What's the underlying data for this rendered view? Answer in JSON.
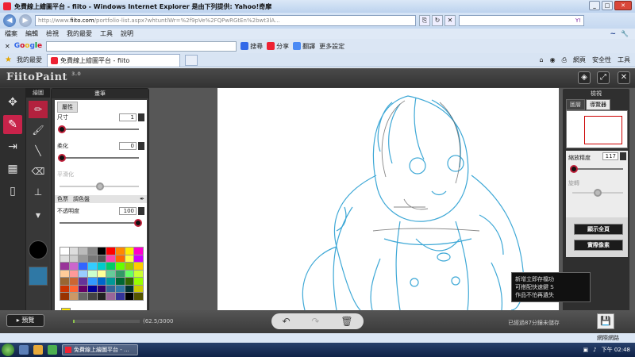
{
  "window": {
    "title": "免費線上繪圖平台 - fiito - Windows Internet Explorer 是由下列提供: Yahoo!奇摩"
  },
  "address": {
    "url_domain": "fiito.com",
    "url_prefix": "http://www.",
    "url_rest": "/portfolio-list.aspx?whtuntlWr=%2f9pVe%2FQPwRGtEn%2bwt3lA..."
  },
  "ie_menu": {
    "items": [
      "檔案",
      "編輯",
      "檢視",
      "我的最愛",
      "工具",
      "說明"
    ]
  },
  "google_bar": {
    "search_label": "搜尋",
    "share_label": "分享",
    "translate_label": "翻譯",
    "more_label": "更多設定"
  },
  "tabs": {
    "favorites_label": "我的最愛",
    "active_tab": "免費線上繪圖平台 - fiito",
    "tools": [
      "網頁",
      "安全性",
      "工具"
    ]
  },
  "app": {
    "logo": "FiitoPaint",
    "version": "3.0",
    "main_tools_label": "繪圖",
    "brush_panel_title": "畫筆",
    "brush_props_tab": "屬性",
    "size_label": "尺寸",
    "size_value": "1",
    "softness_label": "柔化",
    "softness_value": "0",
    "smoothing_label": "平滑化",
    "color_tab_palette": "色票",
    "color_tab_mixer": "調色盤",
    "opacity_label": "不透明度",
    "opacity_value": "100",
    "palette": [
      "#ffffff",
      "#dddddd",
      "#bbbbbb",
      "#888888",
      "#000000",
      "#ff0000",
      "#ff8800",
      "#ffee00",
      "#ff00cc",
      "#dddddd",
      "#cccccc",
      "#999999",
      "#777777",
      "#555555",
      "#ff44aa",
      "#ff6600",
      "#ffff44",
      "#cc00ff",
      "#993399",
      "#cc66cc",
      "#3366ff",
      "#33ccff",
      "#00cccc",
      "#00cc66",
      "#66ff00",
      "#99cc00",
      "#ffcc00",
      "#ffcc99",
      "#ff9999",
      "#99ccff",
      "#ccffcc",
      "#ffff99",
      "#66cc99",
      "#339966",
      "#66ff66",
      "#ccff33",
      "#996633",
      "#cc6633",
      "#663399",
      "#3399ff",
      "#0066cc",
      "#009999",
      "#006633",
      "#336600",
      "#99ff00",
      "#cc3300",
      "#ff6633",
      "#660066",
      "#000099",
      "#330066",
      "#336699",
      "#2f78a5",
      "#003333",
      "#cccc00",
      "#993300",
      "#cc9966",
      "#666666",
      "#444444",
      "#222222",
      "#996699",
      "#333399",
      "#000000",
      "#555500"
    ],
    "current_color": "#ffe600",
    "brush_color_value": "#000000",
    "secondary_color_value": "#2f78a5",
    "navigator_title": "檢視",
    "nav_tab_layers": "圖層",
    "nav_tab_navigator": "導覽器",
    "zoom_label": "縮放精度",
    "zoom_value": "117",
    "rotate_label": "旋轉",
    "fit_button": "顯示全頁",
    "actual_button": "實際像素",
    "tooltip_lines": [
      "新增立即存檔功",
      "可搭配快速鍵 S",
      "作品不怕再遺失"
    ],
    "preview_button": "預覽",
    "capacity_text": "(62.5/3000",
    "capacity_fraction": 0.02,
    "status_text": "已經過87分鐘未儲存",
    "undo_icon": "undo-icon",
    "redo_icon": "redo-icon",
    "trash_icon": "trash-icon"
  },
  "ie_status": {
    "zone": "網際網路"
  },
  "taskbar": {
    "task_label": "免費線上繪圖平台 - ...",
    "clock": "下午 02:48"
  }
}
